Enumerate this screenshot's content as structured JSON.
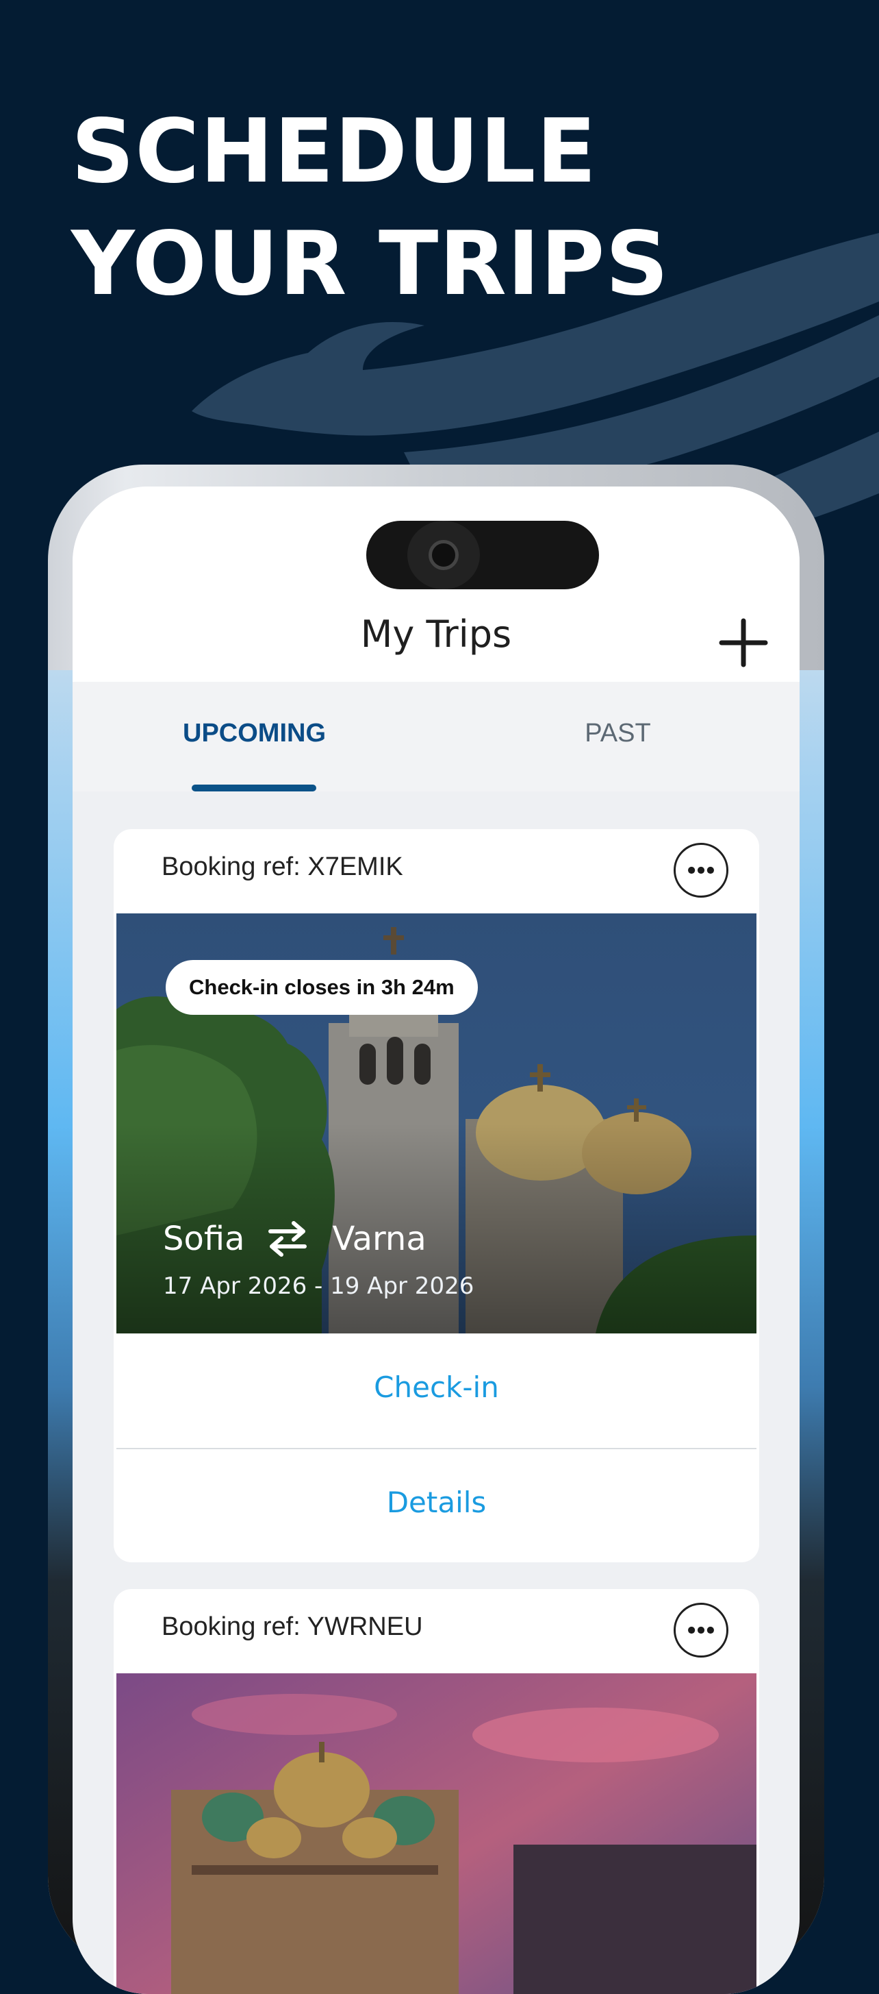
{
  "promo": {
    "headline_line1": "SCHEDULE",
    "headline_line2": "YOUR TRIPS"
  },
  "app": {
    "title": "My Trips",
    "add_icon": "plus-icon"
  },
  "tabs": [
    {
      "label": "UPCOMING",
      "active": true
    },
    {
      "label": "PAST",
      "active": false
    }
  ],
  "trips": [
    {
      "booking_ref": "Booking ref: X7EMIK",
      "badge": "Check-in closes in 3h 24m",
      "from": "Sofia",
      "to": "Varna",
      "dates": "17 Apr 2026 - 19 Apr 2026",
      "actions": {
        "checkin": "Check-in",
        "details": "Details"
      }
    },
    {
      "booking_ref": "Booking ref: YWRNEU"
    }
  ],
  "colors": {
    "background": "#041c33",
    "accent": "#0b4c87",
    "link": "#1a9be0"
  }
}
